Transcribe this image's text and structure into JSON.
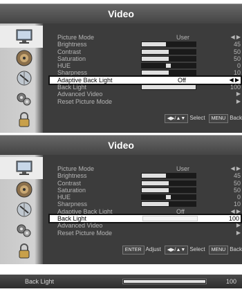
{
  "panel1": {
    "title": "Video",
    "selected_row": 7,
    "items": [
      {
        "label": "Picture Mode",
        "value": "User",
        "type": "text"
      },
      {
        "label": "Brightness",
        "value": "45",
        "type": "bar",
        "level": 0.45
      },
      {
        "label": "Contrast",
        "value": "50",
        "type": "bar",
        "level": 0.5
      },
      {
        "label": "Saturation",
        "value": "50",
        "type": "bar",
        "level": 0.5
      },
      {
        "label": "HUE",
        "value": "0",
        "type": "hue",
        "level": 0.5
      },
      {
        "label": "Sharpness",
        "value": "10",
        "type": "bar",
        "level": 0.5
      },
      {
        "label": "Adaptive Back Light",
        "value": "Off",
        "type": "text"
      },
      {
        "label": "Back Light",
        "value": "100",
        "type": "bar",
        "level": 1.0
      },
      {
        "label": "Advanced Video",
        "value": "",
        "type": "arrow"
      },
      {
        "label": "Reset Picture Mode",
        "value": "",
        "type": "arrow"
      }
    ],
    "footer": {
      "select_text": "Select",
      "menu_key": "MENU",
      "menu_text": "Back",
      "arrows_key": "◀▶/▲▼"
    }
  },
  "panel2": {
    "title": "Video",
    "selected_row": 8,
    "items": [
      {
        "label": "Picture Mode",
        "value": "User",
        "type": "text"
      },
      {
        "label": "Brightness",
        "value": "45",
        "type": "bar",
        "level": 0.45
      },
      {
        "label": "Contrast",
        "value": "50",
        "type": "bar",
        "level": 0.5
      },
      {
        "label": "Saturation",
        "value": "50",
        "type": "bar",
        "level": 0.5
      },
      {
        "label": "HUE",
        "value": "0",
        "type": "hue",
        "level": 0.5
      },
      {
        "label": "Sharpness",
        "value": "10",
        "type": "bar",
        "level": 0.5
      },
      {
        "label": "Adaptive Back Light",
        "value": "Off",
        "type": "text"
      },
      {
        "label": "Back Light",
        "value": "100",
        "type": "bar",
        "level": 1.0
      },
      {
        "label": "Advanced Video",
        "value": "",
        "type": "arrow"
      },
      {
        "label": "Reset Picture Mode",
        "value": "",
        "type": "arrow"
      }
    ],
    "footer": {
      "enter_key": "ENTER",
      "adjust_text": "Adjust",
      "select_text": "Select",
      "menu_key": "MENU",
      "menu_text": "Back",
      "arrows_key": "◀▶/▲▼"
    }
  },
  "bottom": {
    "label": "Back Light",
    "value": "100",
    "level": 1.0
  },
  "colors": {
    "selection_outline": "#111111",
    "menu_bg": "#3c3c3c",
    "text": "#b6b6b6"
  },
  "icons": [
    "monitor-icon",
    "speaker-icon",
    "satellite-icon",
    "gears-icon",
    "padlock-icon"
  ]
}
